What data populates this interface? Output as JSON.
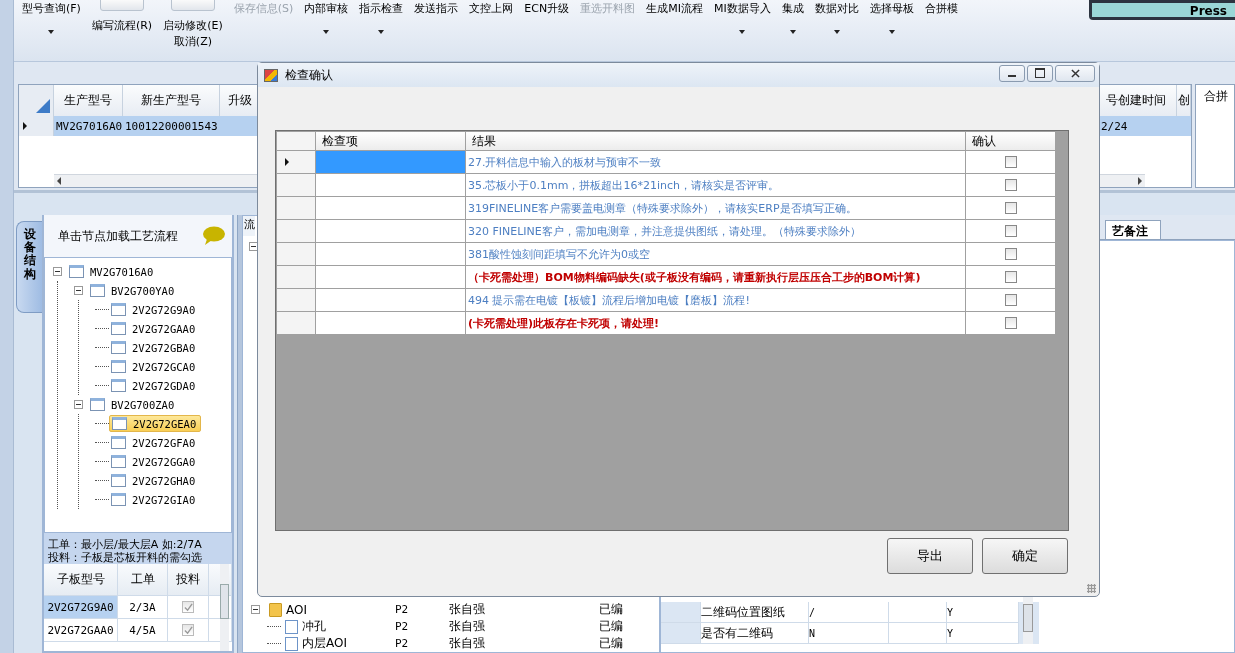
{
  "toolbar": [
    {
      "label": "型号查询(F)",
      "dropdown": true,
      "disabled": false,
      "icon": false
    },
    {
      "label": "编写流程(R)",
      "dropdown": false,
      "disabled": false,
      "icon": true
    },
    {
      "label": "启动修改(E)",
      "label_2": "取消(Z)",
      "dropdown": false,
      "disabled": false,
      "icon": true
    },
    {
      "label": "保存信息(S)",
      "dropdown": false,
      "disabled": true,
      "icon": false
    },
    {
      "label": "内部审核",
      "dropdown": true,
      "disabled": false,
      "icon": false
    },
    {
      "label": "指示检查",
      "dropdown": true,
      "disabled": false,
      "icon": false
    },
    {
      "label": "发送指示",
      "dropdown": false,
      "disabled": false,
      "icon": false
    },
    {
      "label": "文控上网",
      "dropdown": false,
      "disabled": false,
      "icon": false
    },
    {
      "label": "ECN升级",
      "dropdown": false,
      "disabled": false,
      "icon": false
    },
    {
      "label": "重选开料图",
      "dropdown": false,
      "disabled": true,
      "icon": false
    },
    {
      "label": "生成MI流程",
      "dropdown": false,
      "disabled": false,
      "icon": false
    },
    {
      "label": "MI数据导入",
      "dropdown": true,
      "disabled": false,
      "icon": false
    },
    {
      "label": "集成",
      "dropdown": true,
      "disabled": false,
      "icon": false
    },
    {
      "label": "数据对比",
      "dropdown": true,
      "disabled": false,
      "icon": false
    },
    {
      "label": "选择母板",
      "dropdown": true,
      "disabled": false,
      "icon": false
    },
    {
      "label": "合拼模",
      "dropdown": false,
      "disabled": false,
      "icon": false
    }
  ],
  "press_panel": {
    "label": "Press"
  },
  "model_grid": {
    "columns": [
      "生产型号",
      "新生产型号",
      "升级",
      "号创建时间",
      "创"
    ],
    "rows": [
      {
        "selected": true,
        "product_model": "MV2G7016A0",
        "new_product_model": "10012200001543",
        "created_time": "2/24"
      }
    ]
  },
  "side_panel": {
    "title": "合拼"
  },
  "structure_panel": {
    "tab": "设备结构",
    "header": "单击节点加载工艺流程",
    "tree": [
      {
        "label": "MV2G7016A0",
        "expanded": true,
        "selected": false,
        "children": [
          {
            "label": "BV2G700YA0",
            "expanded": true,
            "selected": false,
            "children": [
              {
                "label": "2V2G72G9A0",
                "selected": false
              },
              {
                "label": "2V2G72GAA0",
                "selected": false
              },
              {
                "label": "2V2G72GBA0",
                "selected": false
              },
              {
                "label": "2V2G72GCA0",
                "selected": false
              },
              {
                "label": "2V2G72GDA0",
                "selected": false
              }
            ]
          },
          {
            "label": "BV2G700ZA0",
            "expanded": true,
            "selected": false,
            "children": [
              {
                "label": "2V2G72GEA0",
                "selected": true
              },
              {
                "label": "2V2G72GFA0",
                "selected": false
              },
              {
                "label": "2V2G72GGA0",
                "selected": false
              },
              {
                "label": "2V2G72GHA0",
                "selected": false
              },
              {
                "label": "2V2G72GIA0",
                "selected": false
              }
            ]
          }
        ]
      }
    ],
    "notes": [
      "工单：最小层/最大层A 如:2/7A",
      "投料：子板是芯板开料的需勾选"
    ],
    "board_table": {
      "columns": [
        "子板型号",
        "工单",
        "投料"
      ],
      "rows": [
        {
          "model": "2V2G72G9A0",
          "order": "2/3A",
          "feed": true,
          "selected": true
        },
        {
          "model": "2V2G72GAA0",
          "order": "4/5A",
          "feed": true,
          "selected": false
        }
      ]
    }
  },
  "flow_panel": {
    "tab": "流",
    "tree": [
      {
        "label": "AOI",
        "kind": "folder",
        "expanded": true,
        "cells": [
          "P2",
          "张自强",
          "已编"
        ],
        "children": [
          {
            "label": "冲孔",
            "kind": "file",
            "cells": [
              "P2",
              "张自强",
              "已编"
            ]
          },
          {
            "label": "内层AOI",
            "kind": "file",
            "cells": [
              "P2",
              "张自强",
              "已编"
            ]
          }
        ]
      }
    ]
  },
  "notes_panel": {
    "tabs": [
      {
        "label": "艺备注",
        "selected": true
      }
    ],
    "rows": [
      {
        "item": "二维码位置图纸",
        "value": "/",
        "flag": "Y"
      },
      {
        "item": "是否有二维码",
        "value": "N",
        "flag": "Y"
      }
    ]
  },
  "dialog": {
    "title": "检查确认",
    "columns": [
      "检查项",
      "结果",
      "确认"
    ],
    "rows": [
      {
        "result": "27.开料信息中输入的板材与预审不一致",
        "kind": "info",
        "confirmed": false,
        "selected": true
      },
      {
        "result": "35.芯板小于0.1mm，拼板超出16*21inch，请核实是否评审。",
        "kind": "info",
        "confirmed": false,
        "selected": false
      },
      {
        "result": "319FINELINE客户需要盖电测章（特殊要求除外），请核实ERP是否填写正确。",
        "kind": "info",
        "confirmed": false,
        "selected": false
      },
      {
        "result": "320 FINELINE客户，需加电测章，并注意提供图纸，请处理。（特殊要求除外）",
        "kind": "info",
        "confirmed": false,
        "selected": false
      },
      {
        "result": "381酸性蚀刻间距填写不允许为0或空",
        "kind": "info",
        "confirmed": false,
        "selected": false
      },
      {
        "result": "（卡死需处理）BOM物料编码缺失(或子板没有编码，请重新执行层压压合工步的BOM计算)",
        "kind": "error",
        "confirmed": false,
        "selected": false
      },
      {
        "result": "494 提示需在电镀【板镀】流程后增加电镀【磨板】流程!",
        "kind": "info",
        "confirmed": false,
        "selected": false
      },
      {
        "result": "(卡死需处理)此板存在卡死项，请处理!",
        "kind": "error",
        "confirmed": false,
        "selected": false
      }
    ],
    "buttons": [
      "导出",
      "确定"
    ]
  }
}
